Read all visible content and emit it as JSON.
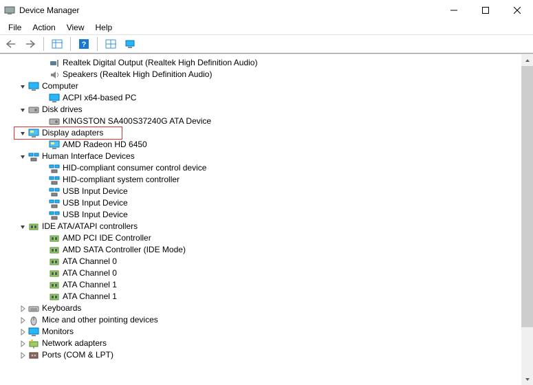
{
  "window": {
    "title": "Device Manager"
  },
  "menubar": {
    "file": "File",
    "action": "Action",
    "view": "View",
    "help": "Help"
  },
  "tree": {
    "nodes": [
      {
        "lvl": 2,
        "exp": "",
        "icon": "audio",
        "label": "Realtek Digital Output (Realtek High Definition Audio)",
        "hl": false
      },
      {
        "lvl": 2,
        "exp": "",
        "icon": "speaker",
        "label": "Speakers (Realtek High Definition Audio)",
        "hl": false
      },
      {
        "lvl": 1,
        "exp": "v",
        "icon": "monitor",
        "label": "Computer",
        "hl": false
      },
      {
        "lvl": 2,
        "exp": "",
        "icon": "monitor",
        "label": "ACPI x64-based PC",
        "hl": false
      },
      {
        "lvl": 1,
        "exp": "v",
        "icon": "disk",
        "label": "Disk drives",
        "hl": false
      },
      {
        "lvl": 2,
        "exp": "",
        "icon": "disk",
        "label": "KINGSTON SA400S37240G ATA Device",
        "hl": false
      },
      {
        "lvl": 1,
        "exp": "v",
        "icon": "display",
        "label": "Display adapters",
        "hl": true
      },
      {
        "lvl": 2,
        "exp": "",
        "icon": "display",
        "label": "AMD Radeon HD 6450",
        "hl": false
      },
      {
        "lvl": 1,
        "exp": "v",
        "icon": "hid",
        "label": "Human Interface Devices",
        "hl": false
      },
      {
        "lvl": 2,
        "exp": "",
        "icon": "hid",
        "label": "HID-compliant consumer control device",
        "hl": false
      },
      {
        "lvl": 2,
        "exp": "",
        "icon": "hid",
        "label": "HID-compliant system controller",
        "hl": false
      },
      {
        "lvl": 2,
        "exp": "",
        "icon": "hid",
        "label": "USB Input Device",
        "hl": false
      },
      {
        "lvl": 2,
        "exp": "",
        "icon": "hid",
        "label": "USB Input Device",
        "hl": false
      },
      {
        "lvl": 2,
        "exp": "",
        "icon": "hid",
        "label": "USB Input Device",
        "hl": false
      },
      {
        "lvl": 1,
        "exp": "v",
        "icon": "ide",
        "label": "IDE ATA/ATAPI controllers",
        "hl": false
      },
      {
        "lvl": 2,
        "exp": "",
        "icon": "ide",
        "label": "AMD PCI IDE Controller",
        "hl": false
      },
      {
        "lvl": 2,
        "exp": "",
        "icon": "ide",
        "label": "AMD SATA Controller (IDE Mode)",
        "hl": false
      },
      {
        "lvl": 2,
        "exp": "",
        "icon": "ide",
        "label": "ATA Channel 0",
        "hl": false
      },
      {
        "lvl": 2,
        "exp": "",
        "icon": "ide",
        "label": "ATA Channel 0",
        "hl": false
      },
      {
        "lvl": 2,
        "exp": "",
        "icon": "ide",
        "label": "ATA Channel 1",
        "hl": false
      },
      {
        "lvl": 2,
        "exp": "",
        "icon": "ide",
        "label": "ATA Channel 1",
        "hl": false
      },
      {
        "lvl": 1,
        "exp": ">",
        "icon": "keyboard",
        "label": "Keyboards",
        "hl": false
      },
      {
        "lvl": 1,
        "exp": ">",
        "icon": "mouse",
        "label": "Mice and other pointing devices",
        "hl": false
      },
      {
        "lvl": 1,
        "exp": ">",
        "icon": "monitor",
        "label": "Monitors",
        "hl": false
      },
      {
        "lvl": 1,
        "exp": ">",
        "icon": "network",
        "label": "Network adapters",
        "hl": false
      },
      {
        "lvl": 1,
        "exp": ">",
        "icon": "port",
        "label": "Ports (COM & LPT)",
        "hl": false
      }
    ]
  }
}
